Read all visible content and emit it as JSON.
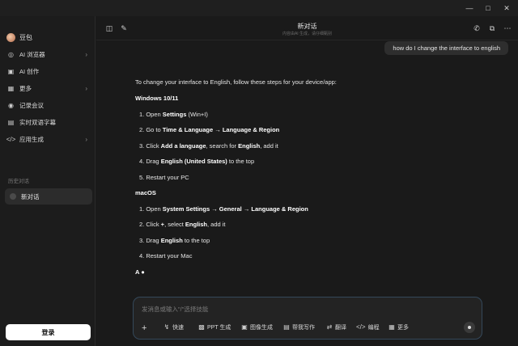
{
  "window": {
    "minimize_icon": "minimize-icon",
    "maximize_icon": "maximize-icon",
    "close_icon": "close-icon"
  },
  "sidebar": {
    "brand": "豆包",
    "items": [
      {
        "label": "AI 浏览器",
        "icon": "compass-icon",
        "has_chevron": true
      },
      {
        "label": "AI 创作",
        "icon": "image-icon",
        "has_chevron": false
      },
      {
        "label": "更多",
        "icon": "grid-icon",
        "has_chevron": true
      },
      {
        "label": "记录会议",
        "icon": "record-icon",
        "has_chevron": false
      },
      {
        "label": "实时双语字幕",
        "icon": "subtitle-icon",
        "has_chevron": false
      },
      {
        "label": "应用生成",
        "icon": "code-icon",
        "has_chevron": true
      }
    ],
    "history_title": "历史对话",
    "history_item": "新对话",
    "login_label": "登录"
  },
  "topbar": {
    "title": "新对话",
    "subtitle": "内容由AI 生成，请仔细甄别"
  },
  "user_message": "how do I change the interface to english",
  "answer": {
    "intro": "To change your interface to English, follow these steps for your device/app:",
    "windows_heading": "Windows 10/11",
    "w1_a": "1. Open ",
    "w1_b": "Settings",
    "w1_c": " (Win+I)",
    "w2_a": "2. Go to ",
    "w2_b": "Time & Language → Language & Region",
    "w3_a": "3. Click ",
    "w3_b": "Add a language",
    "w3_c": ", search for ",
    "w3_d": "English",
    "w3_e": ", add it",
    "w4_a": "4. Drag ",
    "w4_b": "English (United States)",
    "w4_c": " to the top",
    "w5": "5. Restart your PC",
    "mac_heading": "macOS",
    "m1_a": "1. Open ",
    "m1_b": "System Settings → General → Language & Region",
    "m2_a": "2. Click ",
    "m2_b": "+",
    "m2_c": ", select ",
    "m2_d": "English",
    "m2_e": ", add it",
    "m3_a": "3. Drag ",
    "m3_b": "English",
    "m3_c": " to the top",
    "m4": "4. Restart your Mac",
    "streaming": "A ●"
  },
  "composer": {
    "placeholder": "发消息或输入\"/\"选择技能",
    "add_label": "+",
    "tools": [
      {
        "label": "快速",
        "icon": "lightning-icon"
      },
      {
        "label": "PPT 生成",
        "icon": "ppt-icon"
      },
      {
        "label": "图像生成",
        "icon": "image-gen-icon"
      },
      {
        "label": "帮我写作",
        "icon": "write-icon"
      },
      {
        "label": "翻译",
        "icon": "translate-icon"
      },
      {
        "label": "编程",
        "icon": "code-icon"
      },
      {
        "label": "更多",
        "icon": "grid-icon"
      }
    ]
  }
}
